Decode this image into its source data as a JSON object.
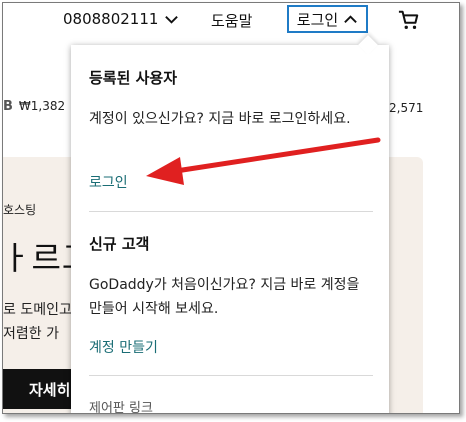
{
  "header": {
    "phone": "0808802111",
    "help": "도움말",
    "login": "로그인"
  },
  "background": {
    "price_left_prefix": "B",
    "price_left": "₩1,382",
    "price_right": "2,571",
    "hero_tag": "호스팅",
    "hero_title": "ㅏ르고",
    "hero_line1": "로 도메인고",
    "hero_line2": "저렴한 가",
    "hero_button": "자세히"
  },
  "dropdown": {
    "registered_title": "등록된 사용자",
    "registered_text": "계정이 있으신가요? 지금 바로 로그인하세요.",
    "login_link": "로그인",
    "new_title": "신규 고객",
    "new_text": "GoDaddy가 처음이신가요? 지금 바로 계정을 만들어 시작해 보세요.",
    "create_link": "계정 만들기",
    "footer_label": "제어판 링크"
  },
  "colors": {
    "accent_border": "#1f7bc6",
    "link": "#1a6d75",
    "annotation": "#e02020"
  },
  "icons": [
    "chevron-down-icon",
    "chevron-up-icon",
    "cart-icon"
  ]
}
